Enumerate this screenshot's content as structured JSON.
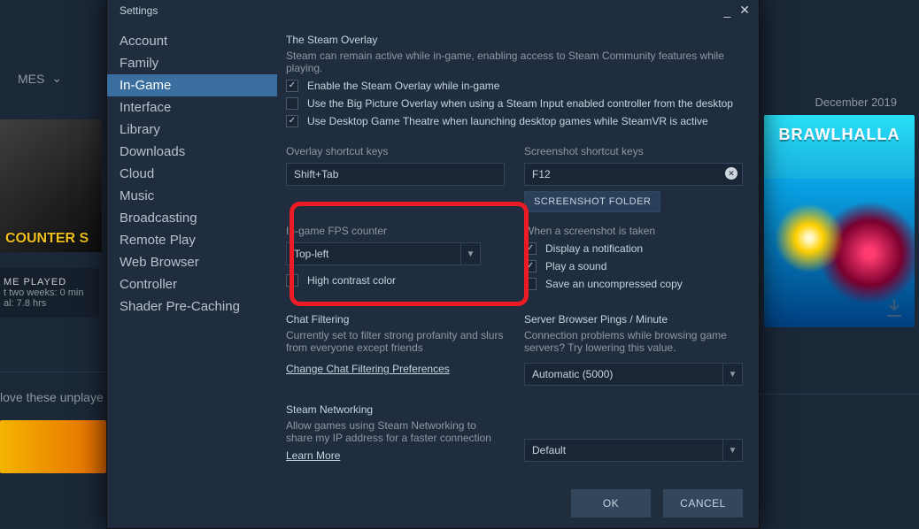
{
  "bg": {
    "nav_mes": "MES",
    "cs_logo": "COUNTER S",
    "stats_head": "ME PLAYED",
    "stats_line1": "t two weeks: 0 min",
    "stats_line2": "al: 7.8 hrs",
    "playnext": "love these unplaye",
    "date": "December 2019",
    "brawlhalla": "BRAWLHALLA"
  },
  "window": {
    "title": "Settings"
  },
  "sidebar": {
    "items": [
      "Account",
      "Family",
      "In-Game",
      "Interface",
      "Library",
      "Downloads",
      "Cloud",
      "Music",
      "Broadcasting",
      "Remote Play",
      "Web Browser",
      "Controller",
      "Shader Pre-Caching"
    ],
    "activeIndex": 2
  },
  "content": {
    "overlay": {
      "title": "The Steam Overlay",
      "desc": "Steam can remain active while in-game, enabling access to Steam Community features while playing.",
      "opt_enable": "Enable the Steam Overlay while in-game",
      "opt_bigpicture": "Use the Big Picture Overlay when using a Steam Input enabled controller from the desktop",
      "opt_gametheatre": "Use Desktop Game Theatre when launching desktop games while SteamVR is active"
    },
    "overlayKeys": {
      "label": "Overlay shortcut keys",
      "value": "Shift+Tab"
    },
    "screenshotKeys": {
      "label": "Screenshot shortcut keys",
      "value": "F12",
      "folder_btn": "SCREENSHOT FOLDER"
    },
    "fps": {
      "label": "In-game FPS counter",
      "value": "Top-left",
      "hc_label": "High contrast color"
    },
    "screenshotTaken": {
      "label": "When a screenshot is taken",
      "opt_notify": "Display a notification",
      "opt_sound": "Play a sound",
      "opt_uncompressed": "Save an uncompressed copy"
    },
    "chat": {
      "title": "Chat Filtering",
      "desc": "Currently set to filter strong profanity and slurs from everyone except friends",
      "link": "Change Chat Filtering Preferences"
    },
    "pings": {
      "title": "Server Browser Pings / Minute",
      "desc": "Connection problems while browsing game servers?  Try lowering this value.",
      "value": "Automatic (5000)"
    },
    "networking": {
      "title": "Steam Networking",
      "desc": "Allow games using Steam Networking to share my IP address for a faster connection",
      "link": "Learn More",
      "value": "Default"
    }
  },
  "footer": {
    "ok": "OK",
    "cancel": "CANCEL"
  }
}
